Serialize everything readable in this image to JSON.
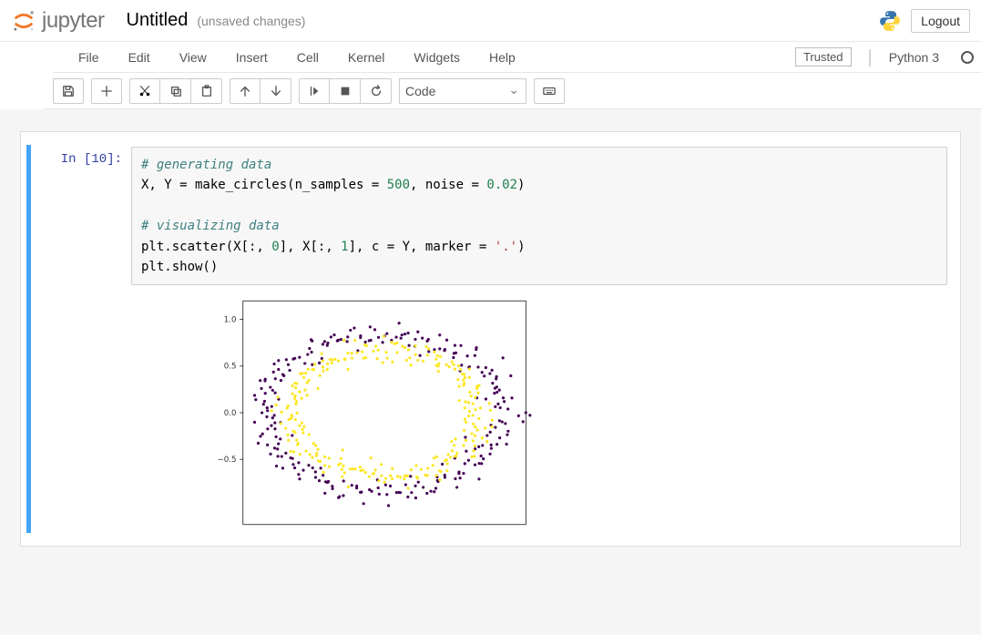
{
  "header": {
    "logo_text": "jupyter",
    "title": "Untitled",
    "status": "(unsaved changes)",
    "logout_label": "Logout"
  },
  "menu": {
    "items": [
      "File",
      "Edit",
      "View",
      "Insert",
      "Cell",
      "Kernel",
      "Widgets",
      "Help"
    ],
    "trusted": "Trusted",
    "kernel": "Python 3"
  },
  "toolbar": {
    "save_icon": "save-icon",
    "add_icon": "add-icon",
    "cut_icon": "cut-icon",
    "copy_icon": "copy-icon",
    "paste_icon": "paste-icon",
    "up_icon": "up-icon",
    "down_icon": "down-icon",
    "run_icon": "run-icon",
    "stop_icon": "stop-icon",
    "restart_icon": "restart-icon",
    "cell_type": "Code",
    "cmd_icon": "keyboard-icon"
  },
  "cell": {
    "prompt": "In [10]:",
    "code_lines": [
      {
        "t": "comment",
        "s": "# generating data"
      },
      {
        "t": "plain_parts",
        "parts": [
          {
            "k": "p",
            "s": "X, Y = make_circles(n_samples = "
          },
          {
            "k": "n",
            "s": "500"
          },
          {
            "k": "p",
            "s": ", noise = "
          },
          {
            "k": "n",
            "s": "0.02"
          },
          {
            "k": "p",
            "s": ")"
          }
        ]
      },
      {
        "t": "blank",
        "s": ""
      },
      {
        "t": "comment",
        "s": "# visualizing data"
      },
      {
        "t": "plain_parts",
        "parts": [
          {
            "k": "p",
            "s": "plt.scatter(X[:, "
          },
          {
            "k": "n",
            "s": "0"
          },
          {
            "k": "p",
            "s": "], X[:, "
          },
          {
            "k": "n",
            "s": "1"
          },
          {
            "k": "p",
            "s": "], c = Y, marker = "
          },
          {
            "k": "s",
            "s": "'.'"
          },
          {
            "k": "p",
            "s": ")"
          }
        ]
      },
      {
        "t": "plain",
        "s": "plt.show()"
      }
    ]
  },
  "chart_data": {
    "type": "scatter",
    "title": "",
    "xlabel": "",
    "ylabel": "",
    "xlim": [
      -1.2,
      1.2
    ],
    "ylim": [
      -1.2,
      1.2
    ],
    "yticks": [
      -0.5,
      0.0,
      0.5,
      1.0
    ],
    "description": "make_circles output: two noisy concentric circles, outer ring Y=0 colored purple (viridis low), inner ring Y=1 colored yellow (viridis high).",
    "series": [
      {
        "name": "class 0 (outer ring)",
        "color": "#440154",
        "shape": "ring",
        "radius": 1.0,
        "noise": 0.02,
        "n_points": 250
      },
      {
        "name": "class 1 (inner ring)",
        "color": "#FDE725",
        "shape": "ring",
        "radius": 0.8,
        "noise": 0.02,
        "n_points": 250
      }
    ]
  }
}
